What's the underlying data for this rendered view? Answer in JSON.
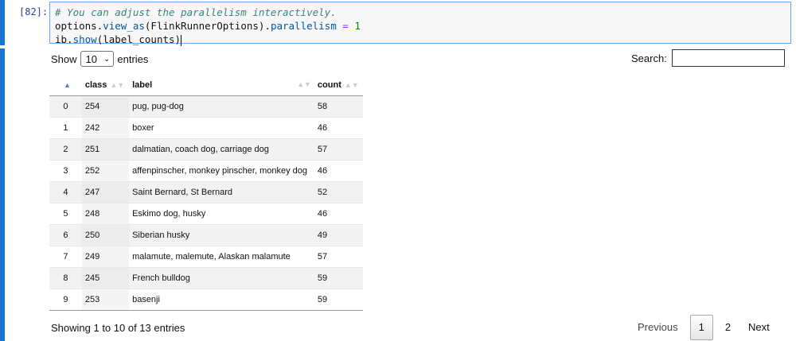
{
  "cell": {
    "prompt": "[82]:",
    "code": {
      "line1_comment": "# You can adjust the parallelism interactively.",
      "line2_obj": "options.",
      "line2_fn": "view_as",
      "line2_arg": "(FlinkRunnerOptions).",
      "line2_attr": "parallelism",
      "line2_eq": " = ",
      "line2_num": "1",
      "line3_obj": "ib.",
      "line3_fn": "show",
      "line3_arg": "(label_counts)"
    }
  },
  "controls": {
    "show_label": "Show",
    "entries_value": "10",
    "entries_label": "entries",
    "search_label": "Search:",
    "search_value": ""
  },
  "table": {
    "headers": [
      "",
      "class",
      "label",
      "count"
    ],
    "rows": [
      [
        "0",
        "254",
        "pug, pug-dog",
        "58"
      ],
      [
        "1",
        "242",
        "boxer",
        "46"
      ],
      [
        "2",
        "251",
        "dalmatian, coach dog, carriage dog",
        "57"
      ],
      [
        "3",
        "252",
        "affenpinscher, monkey pinscher, monkey dog",
        "46"
      ],
      [
        "4",
        "247",
        "Saint Bernard, St Bernard",
        "52"
      ],
      [
        "5",
        "248",
        "Eskimo dog, husky",
        "46"
      ],
      [
        "6",
        "250",
        "Siberian husky",
        "49"
      ],
      [
        "7",
        "249",
        "malamute, malemute, Alaskan malamute",
        "57"
      ],
      [
        "8",
        "245",
        "French bulldog",
        "59"
      ],
      [
        "9",
        "253",
        "basenji",
        "59"
      ]
    ]
  },
  "footer": {
    "info": "Showing 1 to 10 of 13 entries",
    "previous": "Previous",
    "page1": "1",
    "page2": "2",
    "next": "Next"
  },
  "icons": {
    "sort_asc": "sort-asc-icon",
    "sort_both": "sort-both-icon",
    "dropdown": "chevron-down-icon"
  },
  "colors": {
    "cell_bar": "#1976d2",
    "editor_border": "#66a6e8",
    "prompt": "#303f9f"
  }
}
